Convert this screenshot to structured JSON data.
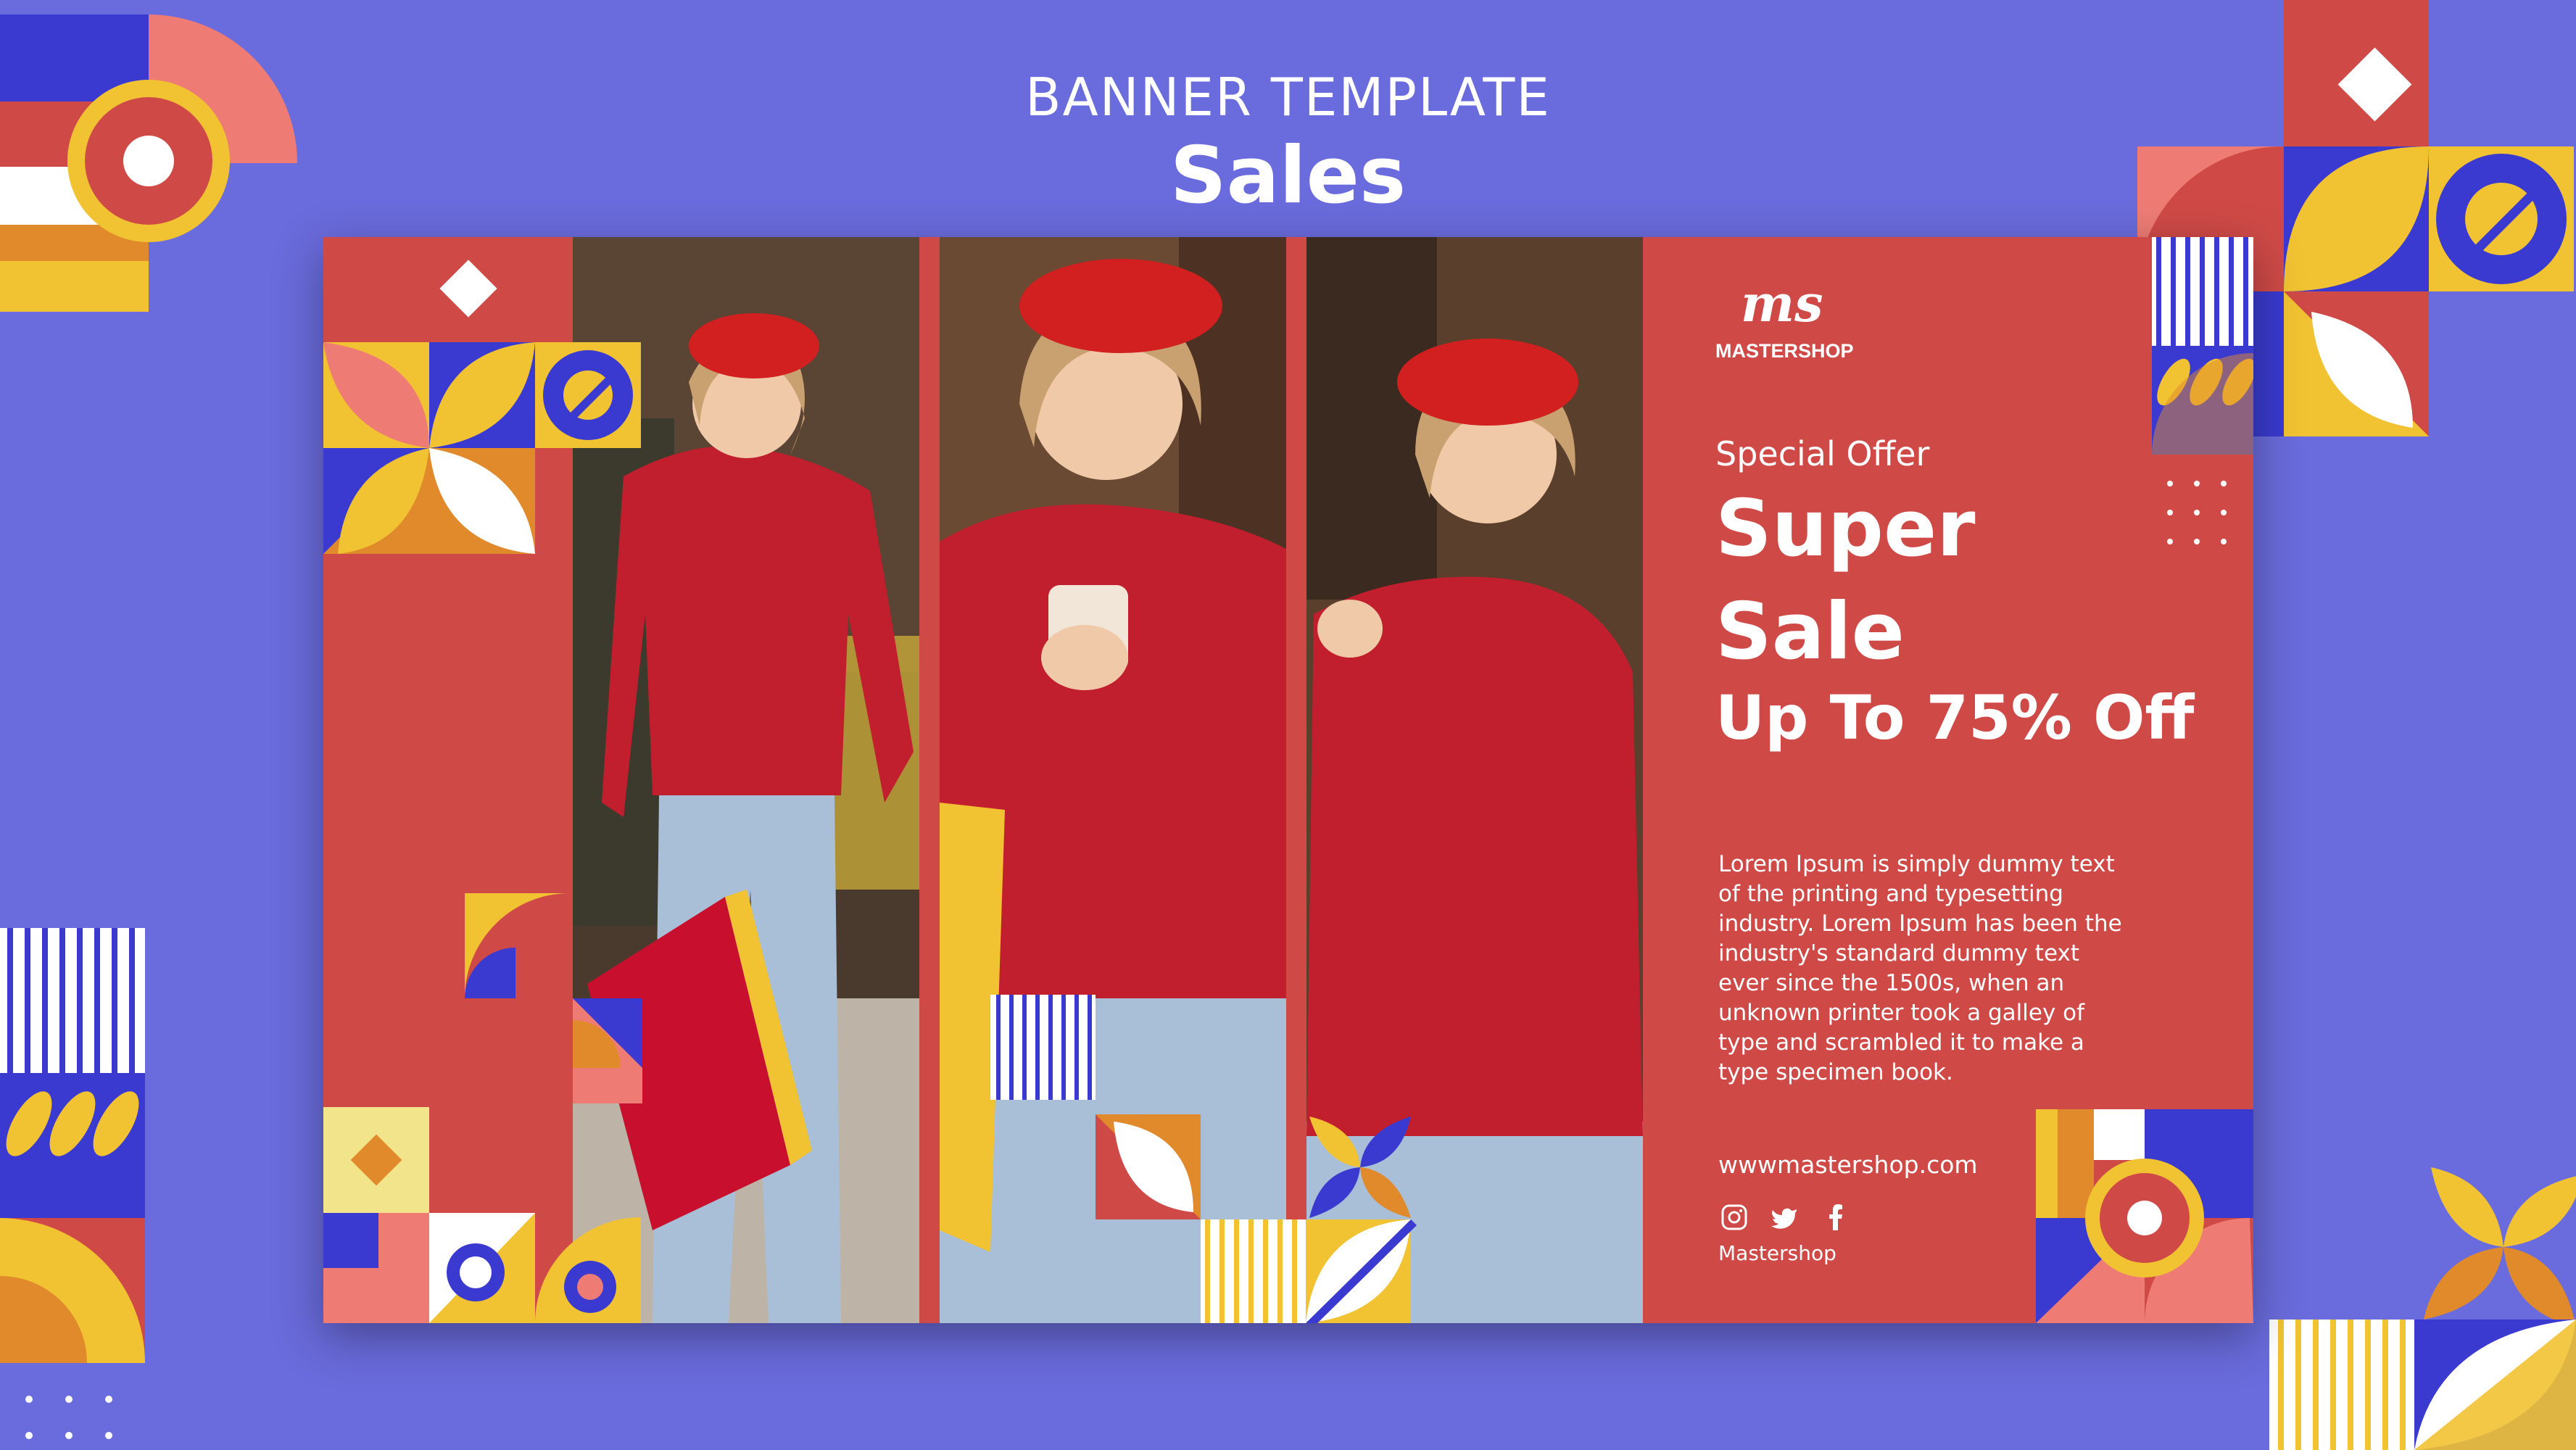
{
  "header": {
    "line1": "BANNER  TEMPLATE",
    "line2": "Sales"
  },
  "banner": {
    "logo": {
      "mark": "ms",
      "name": "MASTERSHOP"
    },
    "special_offer": "Special Offer",
    "headline_1": "Super",
    "headline_2": "Sale",
    "discount": "Up To 75% Off",
    "body": "Lorem Ipsum is simply dummy text of the printing and typesetting industry. Lorem Ipsum has been the industry's standard dummy text ever since the 1500s, when an unknown printer took a galley of type and scrambled it to make a type specimen book.",
    "url": "wwwmastershop.com",
    "social_icons": [
      "instagram-icon",
      "twitter-icon",
      "facebook-icon"
    ],
    "brand_name": "Mastershop"
  },
  "colors": {
    "background": "#6a6bdc",
    "banner_red": "#cf4a47",
    "yellow": "#f1c232",
    "orange": "#e08a2c",
    "blue": "#3a3ad0",
    "pink": "#ee7c75",
    "sweater": "#c21f2e",
    "denim": "#a9bfd8"
  }
}
